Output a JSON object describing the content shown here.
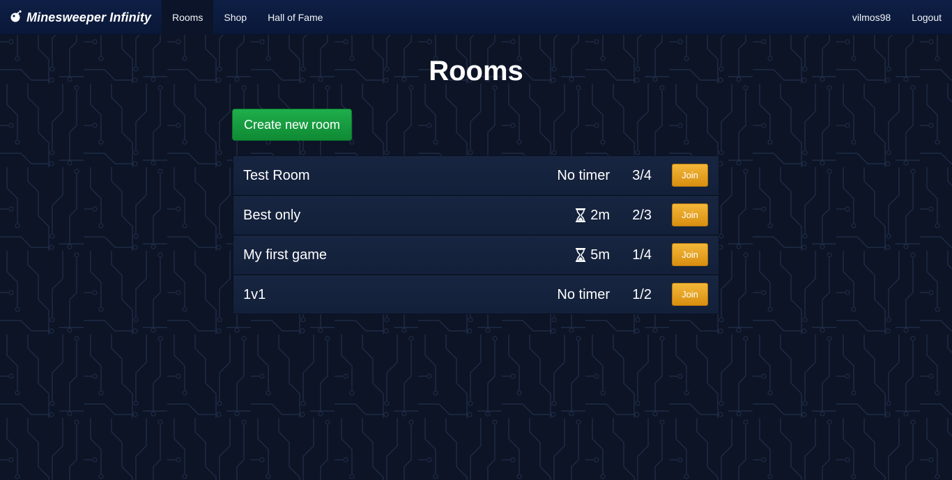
{
  "navbar": {
    "brand": "Minesweeper Infinity",
    "brand_icon": "bomb-icon",
    "links": [
      "Rooms",
      "Shop",
      "Hall of Fame"
    ],
    "active": "Rooms",
    "username": "vilmos98",
    "logout": "Logout"
  },
  "page": {
    "title": "Rooms",
    "create_button": "Create new room"
  },
  "rooms": [
    {
      "name": "Test Room",
      "timer": "No timer",
      "has_timer_icon": false,
      "players": "3/4",
      "join": "Join"
    },
    {
      "name": "Best only",
      "timer": "2m",
      "has_timer_icon": true,
      "players": "2/3",
      "join": "Join"
    },
    {
      "name": "My first game",
      "timer": "5m",
      "has_timer_icon": true,
      "players": "1/4",
      "join": "Join"
    },
    {
      "name": "1v1",
      "timer": "No timer",
      "has_timer_icon": false,
      "players": "1/2",
      "join": "Join"
    }
  ],
  "colors": {
    "background": "#0c1426",
    "navbar": "#0e1f45",
    "create_button": "#1a9e44",
    "join_button": "#e6a020",
    "room_row": "#14213b"
  }
}
